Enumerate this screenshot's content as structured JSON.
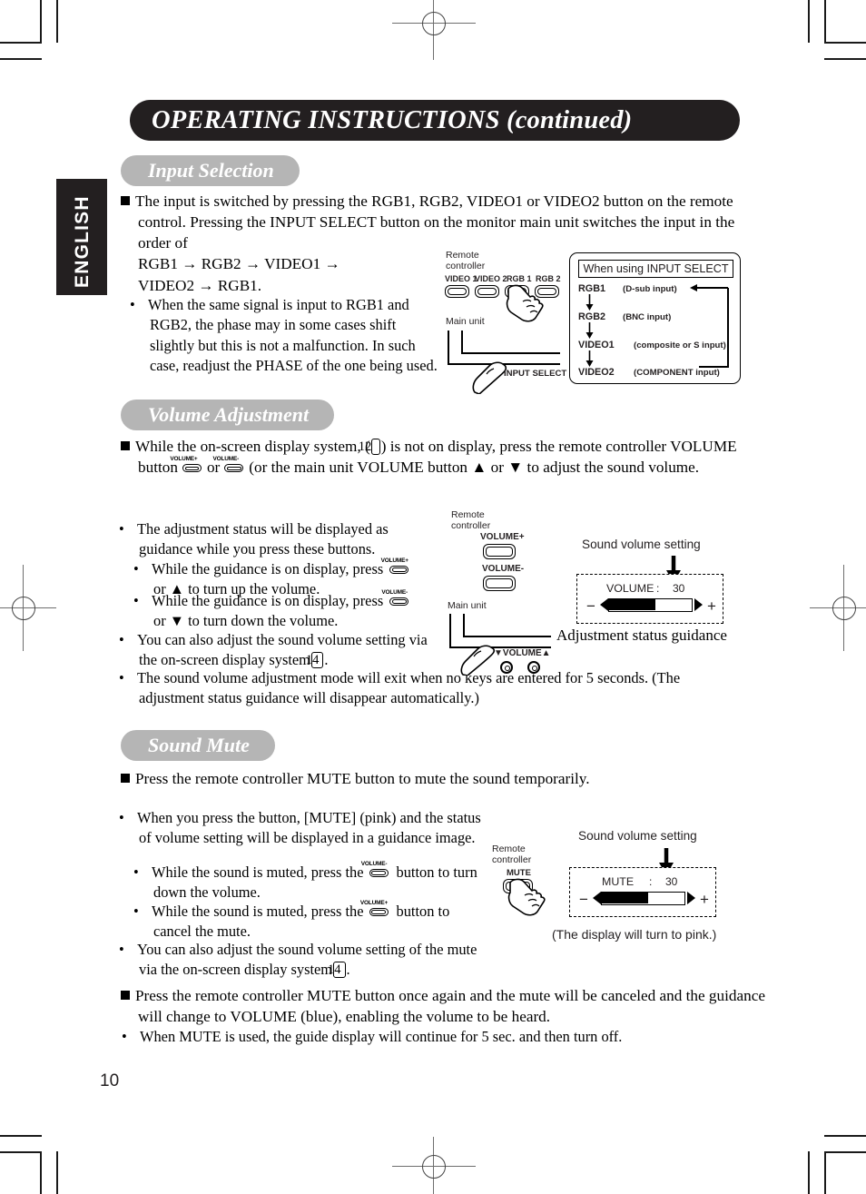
{
  "page": {
    "number": "10",
    "language_tab": "ENGLISH",
    "title": "OPERATING INSTRUCTIONS (continued)"
  },
  "sections": [
    {
      "heading": "Input Selection",
      "paragraphs": [
        "The input is switched by pressing the RGB1, RGB2, VIDEO1 or VIDEO2 button on the remote control. Pressing the INPUT SELECT button on the monitor main unit switches the input in the order of",
        "RGB1 → RGB2 → VIDEO1 →",
        "VIDEO2 → RGB1.",
        "When the same signal is input to RGB1 and RGB2, the phase may in some cases shift slightly but this is not a malfunction. In such case, readjust the PHASE of the one being used."
      ]
    },
    {
      "heading": "Volume Adjustment",
      "paragraphs": [
        "While the on-screen display system, (",
        ") is not on display, press the remote controller VOLUME button",
        "or",
        "(or the main unit VOLUME button ▲ or ▼ to adjust the sound volume."
      ],
      "bullets": [
        "The adjustment status will be displayed as guidance while you press these buttons.",
        "While the guidance is on display, press",
        "or ▲ to turn up the volume.",
        "While the guidance is on display, press",
        "or ▼ to turn down the volume.",
        "You can also adjust the sound volume setting via the on-screen display system",
        "The sound volume adjustment mode will exit when no keys are entered for 5 seconds.  (The adjustment status guidance will disappear automatically.)"
      ]
    },
    {
      "heading": "Sound Mute",
      "paragraphs": [
        "Press the remote controller MUTE button to mute the sound temporarily."
      ],
      "bullets": [
        "When you press the button, [MUTE] (pink) and the status of volume setting will be displayed in a guidance image.",
        "While the sound is muted, press the",
        "button to turn down the volume.",
        "While the sound is muted, press the",
        "button to cancel the mute.",
        "You can also adjust the sound volume setting of the mute via the on-screen display system"
      ],
      "closing": [
        "Press the remote controller MUTE button once again and the mute will be canceled and the guidance will change to VOLUME (blue), enabling the volume to be heard.",
        "When MUTE is used, the guide display will continue for 5 sec. and then turn off."
      ]
    }
  ],
  "page_refs": {
    "osd_12": "12",
    "osd_14": "14",
    "osd_14b": "14"
  },
  "figures": {
    "input_selection": {
      "remote_label": "Remote\ncontroller",
      "main_unit_label": "Main unit",
      "input_select_label": "INPUT SELECT",
      "buttons": [
        "VIDEO 1",
        "VIDEO 2",
        "RGB 1",
        "RGB 2"
      ]
    },
    "input_select_box": {
      "title": "When using INPUT SELECT",
      "rows": [
        {
          "name": "RGB1",
          "desc": "(D-sub input)"
        },
        {
          "name": "RGB2",
          "desc": "(BNC input)"
        },
        {
          "name": "VIDEO1",
          "desc": "(composite or S input)"
        },
        {
          "name": "VIDEO2",
          "desc": "(COMPONENT input)"
        }
      ]
    },
    "volume_figure": {
      "remote_label": "Remote\ncontroller",
      "volume_plus": "VOLUME+",
      "volume_minus": "VOLUME-",
      "main_unit_label": "Main unit",
      "main_unit_knob_label": "▼VOLUME▲",
      "sound_volume_setting": "Sound volume setting",
      "osd_name": "VOLUME",
      "osd_colon": ":",
      "osd_value": "30",
      "minus": "−",
      "plus": "+",
      "caption": "Adjustment status guidance",
      "gauge_percent": 55
    },
    "mute_figure": {
      "remote_label": "Remote\ncontroller",
      "mute_button_label": "MUTE",
      "sound_volume_setting": "Sound volume setting",
      "osd_name": "MUTE",
      "osd_colon": ":",
      "osd_value": "30",
      "minus": "−",
      "plus": "+",
      "caption": "(The display will turn to pink.)",
      "gauge_percent": 55
    }
  },
  "inline_buttons": {
    "volume_plus": "VOLUME+",
    "volume_minus": "VOLUME-"
  }
}
